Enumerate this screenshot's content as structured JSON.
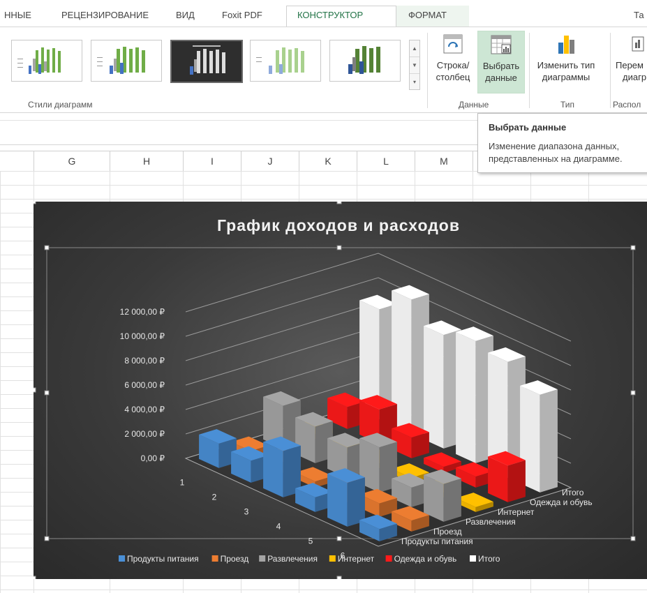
{
  "tabs": [
    "ННЫЕ",
    "РЕЦЕНЗИРОВАНИЕ",
    "ВИД",
    "Foxit PDF",
    "КОНСТРУКТОР",
    "ФОРМАТ",
    "Та"
  ],
  "ribbon": {
    "styles_group_label": "Стили диаграмм",
    "data_group_label": "Данные",
    "type_group_label": "Тип",
    "layout_group_label": "Распол",
    "btn_row_col": [
      "Строка/",
      "столбец"
    ],
    "btn_select_data": [
      "Выбрать",
      "данные"
    ],
    "btn_change_type": [
      "Изменить тип",
      "диаграммы"
    ],
    "btn_move": [
      "Перем",
      "диагр"
    ]
  },
  "tooltip": {
    "title": "Выбрать данные",
    "text1": "Изменение диапазона данных,",
    "text2": "представленных на диаграмме."
  },
  "columns": [
    "G",
    "H",
    "I",
    "J",
    "K",
    "L",
    "M"
  ],
  "colors": {
    "food": "#4a8fd6",
    "travel": "#ed7d31",
    "fun": "#a5a5a5",
    "internet": "#ffc000",
    "clothes": "#ff1a1a",
    "total": "#ffffff",
    "accent": "#217346"
  },
  "chart_data": {
    "type": "bar3d",
    "title": "График доходов и расходов",
    "categories": [
      "1",
      "2",
      "3",
      "4",
      "5",
      "6"
    ],
    "yticks": [
      "0,00 ₽",
      "2 000,00 ₽",
      "4 000,00 ₽",
      "6 000,00 ₽",
      "8 000,00 ₽",
      "10 000,00 ₽",
      "12 000,00 ₽"
    ],
    "ylim": [
      0,
      12000
    ],
    "series": [
      {
        "name": "Продукты питания",
        "values": [
          2000,
          1800,
          3800,
          1200,
          3600,
          1000
        ]
      },
      {
        "name": "Проезд",
        "values": [
          600,
          900,
          500,
          1500,
          1100,
          900
        ]
      },
      {
        "name": "Развлечения",
        "values": [
          3500,
          3000,
          2500,
          3700,
          1600,
          3100
        ]
      },
      {
        "name": "Интернет",
        "values": [
          400,
          400,
          400,
          400,
          400,
          400
        ]
      },
      {
        "name": "Одежда и обувь",
        "values": [
          1800,
          2800,
          1700,
          500,
          900,
          3000
        ]
      },
      {
        "name": "Итого",
        "values": [
          9000,
          11000,
          9300,
          10000,
          9500,
          8000
        ]
      }
    ]
  }
}
